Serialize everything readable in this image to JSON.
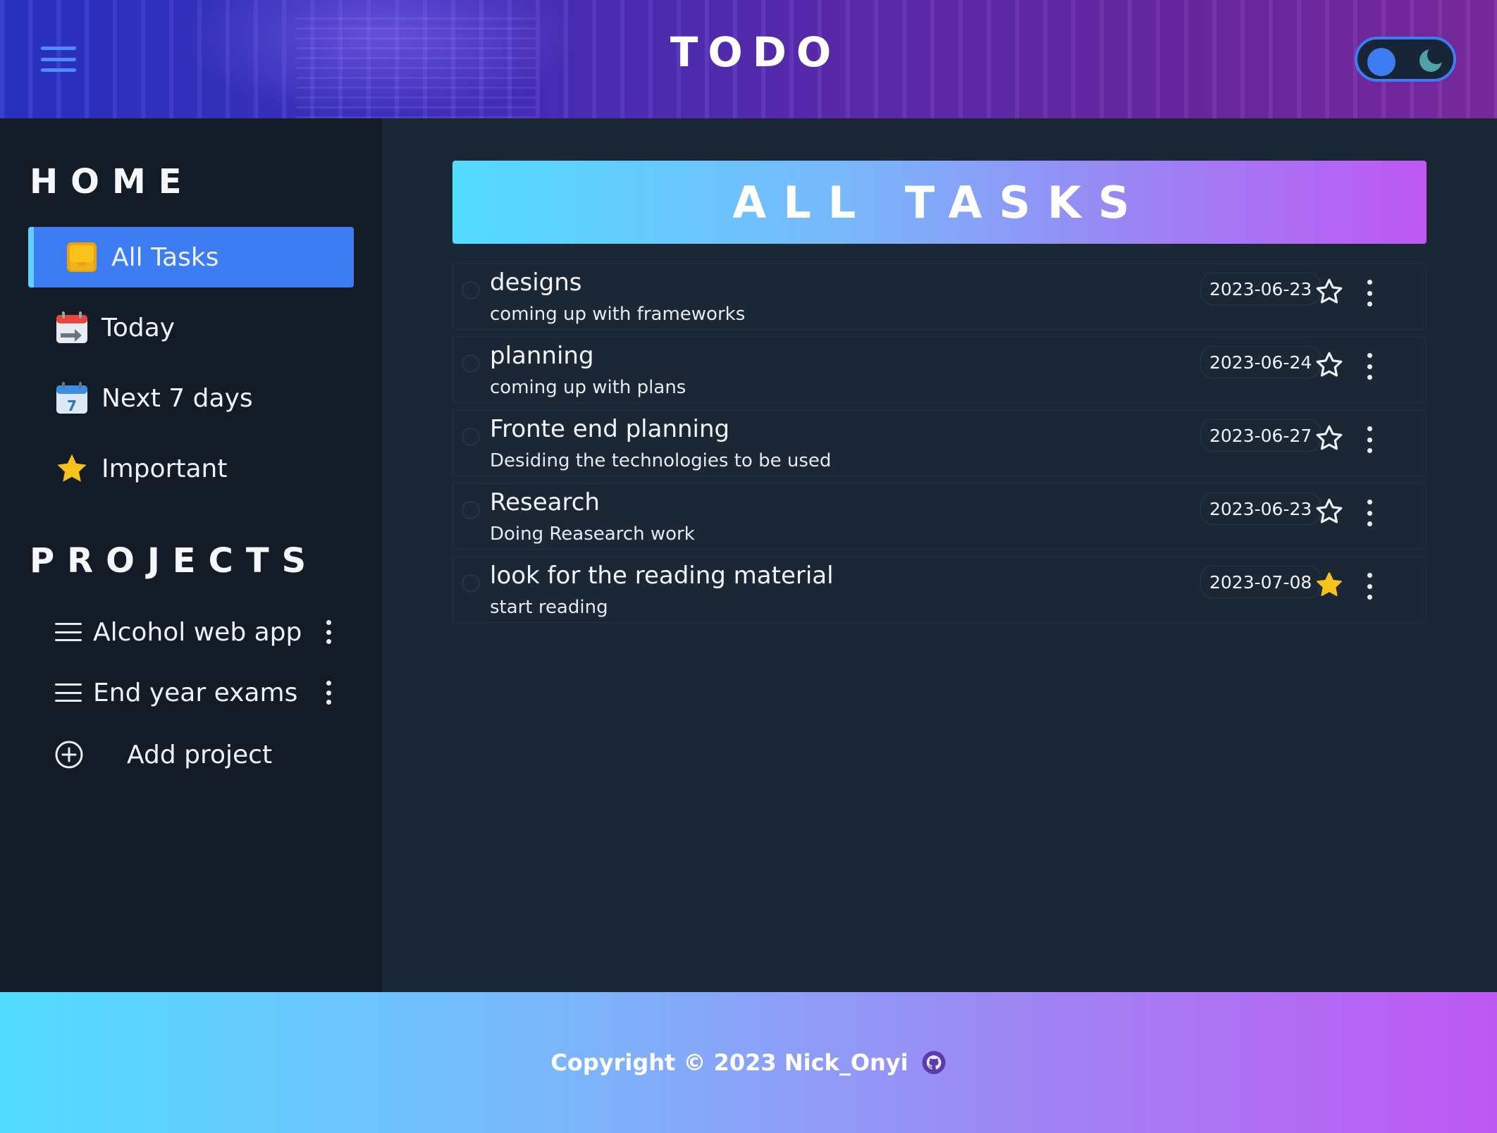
{
  "header": {
    "title": "TODO",
    "menu_icon": "hamburger-icon",
    "theme_toggle_icon": "moon-icon"
  },
  "sidebar": {
    "home_title": "HOME",
    "nav_items": [
      {
        "label": "All Tasks",
        "icon": "inbox-icon",
        "active": true
      },
      {
        "label": "Today",
        "icon": "calendar-arrow-icon",
        "active": false
      },
      {
        "label": "Next 7 days",
        "icon": "calendar-7-icon",
        "active": false
      },
      {
        "label": "Important",
        "icon": "star-icon",
        "active": false
      }
    ],
    "projects_title": "PROJECTS",
    "projects": [
      {
        "label": "Alcohol web app"
      },
      {
        "label": "End year exams"
      }
    ],
    "add_project_label": "Add project"
  },
  "main": {
    "banner_title": "ALL TASKS",
    "tasks": [
      {
        "title": "designs",
        "description": "coming up with frameworks",
        "date": "2023-06-23",
        "important": false
      },
      {
        "title": "planning",
        "description": "coming up with plans",
        "date": "2023-06-24",
        "important": false
      },
      {
        "title": "Fronte end planning",
        "description": "Desiding the technologies to be used",
        "date": "2023-06-27",
        "important": false
      },
      {
        "title": "Research",
        "description": "Doing Reasearch work",
        "date": "2023-06-23",
        "important": false
      },
      {
        "title": "look for the reading material",
        "description": "start reading",
        "date": "2023-07-08",
        "important": true
      }
    ]
  },
  "footer": {
    "copyright": "Copyright © 2023 Nick_Onyi",
    "icon": "github-icon"
  },
  "colors": {
    "accent": "#3d7cf2",
    "sidebar_bg": "#131b26",
    "main_bg": "#1b2735",
    "star_filled": "#f7c31a"
  }
}
